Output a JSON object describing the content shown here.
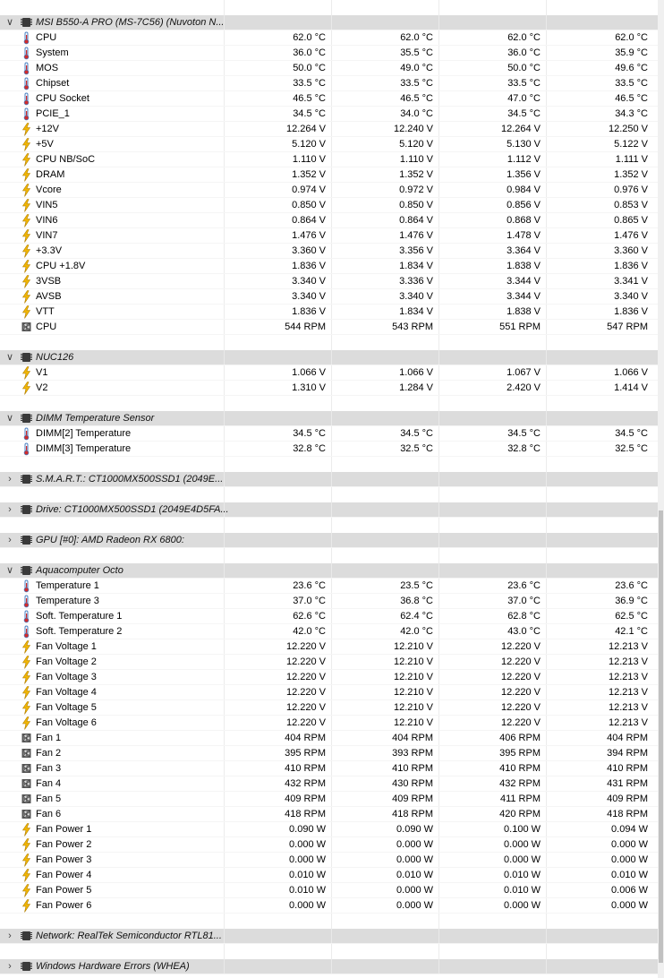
{
  "groups": [
    {
      "title": "MSI B550-A PRO (MS-7C56) (Nuvoton N...",
      "expanded": true,
      "sensors": [
        {
          "icon": "thermometer",
          "label": "CPU",
          "values": [
            "62.0 °C",
            "62.0 °C",
            "62.0 °C",
            "62.0 °C"
          ]
        },
        {
          "icon": "thermometer",
          "label": "System",
          "values": [
            "36.0 °C",
            "35.5 °C",
            "36.0 °C",
            "35.9 °C"
          ]
        },
        {
          "icon": "thermometer",
          "label": "MOS",
          "values": [
            "50.0 °C",
            "49.0 °C",
            "50.0 °C",
            "49.6 °C"
          ]
        },
        {
          "icon": "thermometer",
          "label": "Chipset",
          "values": [
            "33.5 °C",
            "33.5 °C",
            "33.5 °C",
            "33.5 °C"
          ]
        },
        {
          "icon": "thermometer",
          "label": "CPU Socket",
          "values": [
            "46.5 °C",
            "46.5 °C",
            "47.0 °C",
            "46.5 °C"
          ]
        },
        {
          "icon": "thermometer",
          "label": "PCIE_1",
          "values": [
            "34.5 °C",
            "34.0 °C",
            "34.5 °C",
            "34.3 °C"
          ]
        },
        {
          "icon": "bolt",
          "label": "+12V",
          "values": [
            "12.264 V",
            "12.240 V",
            "12.264 V",
            "12.250 V"
          ]
        },
        {
          "icon": "bolt",
          "label": "+5V",
          "values": [
            "5.120 V",
            "5.120 V",
            "5.130 V",
            "5.122 V"
          ]
        },
        {
          "icon": "bolt",
          "label": "CPU NB/SoC",
          "values": [
            "1.110 V",
            "1.110 V",
            "1.112 V",
            "1.111 V"
          ]
        },
        {
          "icon": "bolt",
          "label": "DRAM",
          "values": [
            "1.352 V",
            "1.352 V",
            "1.356 V",
            "1.352 V"
          ]
        },
        {
          "icon": "bolt",
          "label": "Vcore",
          "values": [
            "0.974 V",
            "0.972 V",
            "0.984 V",
            "0.976 V"
          ]
        },
        {
          "icon": "bolt",
          "label": "VIN5",
          "values": [
            "0.850 V",
            "0.850 V",
            "0.856 V",
            "0.853 V"
          ]
        },
        {
          "icon": "bolt",
          "label": "VIN6",
          "values": [
            "0.864 V",
            "0.864 V",
            "0.868 V",
            "0.865 V"
          ]
        },
        {
          "icon": "bolt",
          "label": "VIN7",
          "values": [
            "1.476 V",
            "1.476 V",
            "1.478 V",
            "1.476 V"
          ]
        },
        {
          "icon": "bolt",
          "label": "+3.3V",
          "values": [
            "3.360 V",
            "3.356 V",
            "3.364 V",
            "3.360 V"
          ]
        },
        {
          "icon": "bolt",
          "label": "CPU +1.8V",
          "values": [
            "1.836 V",
            "1.834 V",
            "1.838 V",
            "1.836 V"
          ]
        },
        {
          "icon": "bolt",
          "label": "3VSB",
          "values": [
            "3.340 V",
            "3.336 V",
            "3.344 V",
            "3.341 V"
          ]
        },
        {
          "icon": "bolt",
          "label": "AVSB",
          "values": [
            "3.340 V",
            "3.340 V",
            "3.344 V",
            "3.340 V"
          ]
        },
        {
          "icon": "bolt",
          "label": "VTT",
          "values": [
            "1.836 V",
            "1.834 V",
            "1.838 V",
            "1.836 V"
          ]
        },
        {
          "icon": "fan",
          "label": "CPU",
          "values": [
            "544 RPM",
            "543 RPM",
            "551 RPM",
            "547 RPM"
          ]
        }
      ]
    },
    {
      "title": "NUC126",
      "expanded": true,
      "sensors": [
        {
          "icon": "bolt",
          "label": "V1",
          "values": [
            "1.066 V",
            "1.066 V",
            "1.067 V",
            "1.066 V"
          ]
        },
        {
          "icon": "bolt",
          "label": "V2",
          "values": [
            "1.310 V",
            "1.284 V",
            "2.420 V",
            "1.414 V"
          ]
        }
      ]
    },
    {
      "title": "DIMM Temperature Sensor",
      "expanded": true,
      "sensors": [
        {
          "icon": "thermometer",
          "label": "DIMM[2] Temperature",
          "values": [
            "34.5 °C",
            "34.5 °C",
            "34.5 °C",
            "34.5 °C"
          ]
        },
        {
          "icon": "thermometer",
          "label": "DIMM[3] Temperature",
          "values": [
            "32.8 °C",
            "32.5 °C",
            "32.8 °C",
            "32.5 °C"
          ]
        }
      ]
    },
    {
      "title": "S.M.A.R.T.: CT1000MX500SSD1 (2049E...",
      "expanded": false,
      "sensors": []
    },
    {
      "title": "Drive: CT1000MX500SSD1 (2049E4D5FA...",
      "expanded": false,
      "sensors": []
    },
    {
      "title": "GPU [#0]: AMD Radeon RX 6800:",
      "expanded": false,
      "sensors": []
    },
    {
      "title": "Aquacomputer Octo",
      "expanded": true,
      "sensors": [
        {
          "icon": "thermometer",
          "label": "Temperature 1",
          "values": [
            "23.6 °C",
            "23.5 °C",
            "23.6 °C",
            "23.6 °C"
          ]
        },
        {
          "icon": "thermometer",
          "label": "Temperature 3",
          "values": [
            "37.0 °C",
            "36.8 °C",
            "37.0 °C",
            "36.9 °C"
          ]
        },
        {
          "icon": "thermometer",
          "label": "Soft. Temperature 1",
          "values": [
            "62.6 °C",
            "62.4 °C",
            "62.8 °C",
            "62.5 °C"
          ]
        },
        {
          "icon": "thermometer",
          "label": "Soft. Temperature 2",
          "values": [
            "42.0 °C",
            "42.0 °C",
            "43.0 °C",
            "42.1 °C"
          ]
        },
        {
          "icon": "bolt",
          "label": "Fan Voltage 1",
          "values": [
            "12.220 V",
            "12.210 V",
            "12.220 V",
            "12.213 V"
          ]
        },
        {
          "icon": "bolt",
          "label": "Fan Voltage 2",
          "values": [
            "12.220 V",
            "12.210 V",
            "12.220 V",
            "12.213 V"
          ]
        },
        {
          "icon": "bolt",
          "label": "Fan Voltage 3",
          "values": [
            "12.220 V",
            "12.210 V",
            "12.220 V",
            "12.213 V"
          ]
        },
        {
          "icon": "bolt",
          "label": "Fan Voltage 4",
          "values": [
            "12.220 V",
            "12.210 V",
            "12.220 V",
            "12.213 V"
          ]
        },
        {
          "icon": "bolt",
          "label": "Fan Voltage 5",
          "values": [
            "12.220 V",
            "12.210 V",
            "12.220 V",
            "12.213 V"
          ]
        },
        {
          "icon": "bolt",
          "label": "Fan Voltage 6",
          "values": [
            "12.220 V",
            "12.210 V",
            "12.220 V",
            "12.213 V"
          ]
        },
        {
          "icon": "fan",
          "label": "Fan 1",
          "values": [
            "404 RPM",
            "404 RPM",
            "406 RPM",
            "404 RPM"
          ]
        },
        {
          "icon": "fan",
          "label": "Fan 2",
          "values": [
            "395 RPM",
            "393 RPM",
            "395 RPM",
            "394 RPM"
          ]
        },
        {
          "icon": "fan",
          "label": "Fan 3",
          "values": [
            "410 RPM",
            "410 RPM",
            "410 RPM",
            "410 RPM"
          ]
        },
        {
          "icon": "fan",
          "label": "Fan 4",
          "values": [
            "432 RPM",
            "430 RPM",
            "432 RPM",
            "431 RPM"
          ]
        },
        {
          "icon": "fan",
          "label": "Fan 5",
          "values": [
            "409 RPM",
            "409 RPM",
            "411 RPM",
            "409 RPM"
          ]
        },
        {
          "icon": "fan",
          "label": "Fan 6",
          "values": [
            "418 RPM",
            "418 RPM",
            "420 RPM",
            "418 RPM"
          ]
        },
        {
          "icon": "bolt",
          "label": "Fan Power 1",
          "values": [
            "0.090 W",
            "0.090 W",
            "0.100 W",
            "0.094 W"
          ]
        },
        {
          "icon": "bolt",
          "label": "Fan Power 2",
          "values": [
            "0.000 W",
            "0.000 W",
            "0.000 W",
            "0.000 W"
          ]
        },
        {
          "icon": "bolt",
          "label": "Fan Power 3",
          "values": [
            "0.000 W",
            "0.000 W",
            "0.000 W",
            "0.000 W"
          ]
        },
        {
          "icon": "bolt",
          "label": "Fan Power 4",
          "values": [
            "0.010 W",
            "0.010 W",
            "0.010 W",
            "0.010 W"
          ]
        },
        {
          "icon": "bolt",
          "label": "Fan Power 5",
          "values": [
            "0.010 W",
            "0.000 W",
            "0.010 W",
            "0.006 W"
          ]
        },
        {
          "icon": "bolt",
          "label": "Fan Power 6",
          "values": [
            "0.000 W",
            "0.000 W",
            "0.000 W",
            "0.000 W"
          ]
        }
      ]
    },
    {
      "title": "Network: RealTek Semiconductor RTL81...",
      "expanded": false,
      "sensors": []
    },
    {
      "title": "Windows Hardware Errors (WHEA)",
      "expanded": false,
      "sensors": []
    }
  ],
  "icons": {
    "expanded_chevron": "∨",
    "collapsed_chevron": "›"
  },
  "colors": {
    "group_background": "#dcdcdc",
    "thermometer_mercury": "#d22b2b",
    "thermometer_tube": "#4a7fc1",
    "bolt": "#f2b705"
  }
}
